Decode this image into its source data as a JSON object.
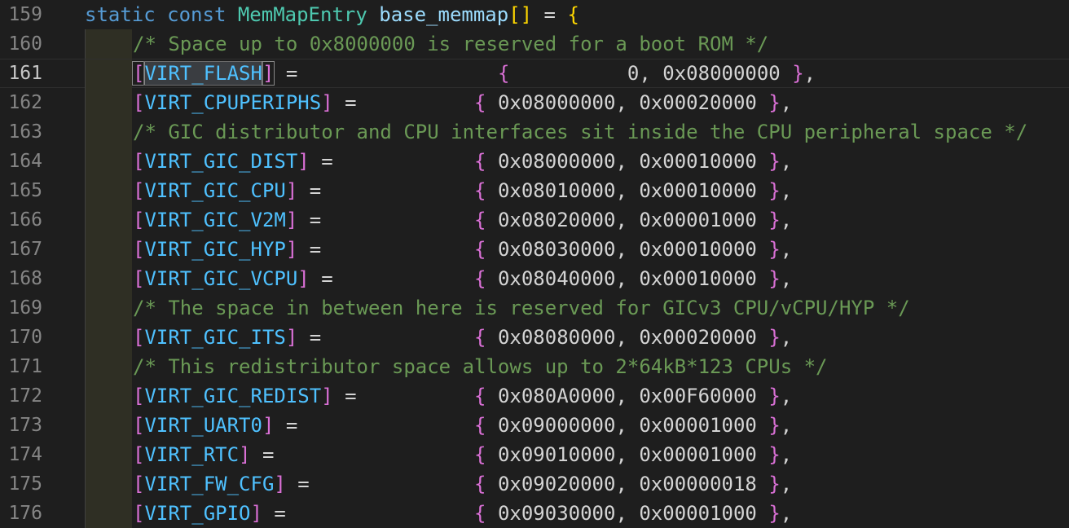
{
  "editor": {
    "lines": [
      {
        "n": "159",
        "kind": "decl",
        "kw": "static const",
        "type": "MemMapEntry",
        "name": "base_memmap",
        "open": "[]",
        "rest": " = ",
        "brace": "{"
      },
      {
        "n": "160",
        "kind": "comment",
        "text": "/* Space up to 0x8000000 is reserved for a boot ROM */"
      },
      {
        "n": "161",
        "kind": "entry",
        "id": "VIRT_FLASH",
        "pad": " =                 ",
        "a": "         0",
        "b": "0x08000000",
        "current": true
      },
      {
        "n": "162",
        "kind": "entry",
        "id": "VIRT_CPUPERIPHS",
        "pad": " =          ",
        "a": "0x08000000",
        "b": "0x00020000"
      },
      {
        "n": "163",
        "kind": "comment",
        "text": "/* GIC distributor and CPU interfaces sit inside the CPU peripheral space */"
      },
      {
        "n": "164",
        "kind": "entry",
        "id": "VIRT_GIC_DIST",
        "pad": " =            ",
        "a": "0x08000000",
        "b": "0x00010000"
      },
      {
        "n": "165",
        "kind": "entry",
        "id": "VIRT_GIC_CPU",
        "pad": " =             ",
        "a": "0x08010000",
        "b": "0x00010000"
      },
      {
        "n": "166",
        "kind": "entry",
        "id": "VIRT_GIC_V2M",
        "pad": " =             ",
        "a": "0x08020000",
        "b": "0x00001000"
      },
      {
        "n": "167",
        "kind": "entry",
        "id": "VIRT_GIC_HYP",
        "pad": " =             ",
        "a": "0x08030000",
        "b": "0x00010000"
      },
      {
        "n": "168",
        "kind": "entry",
        "id": "VIRT_GIC_VCPU",
        "pad": " =            ",
        "a": "0x08040000",
        "b": "0x00010000"
      },
      {
        "n": "169",
        "kind": "comment",
        "text": "/* The space in between here is reserved for GICv3 CPU/vCPU/HYP */"
      },
      {
        "n": "170",
        "kind": "entry",
        "id": "VIRT_GIC_ITS",
        "pad": " =             ",
        "a": "0x08080000",
        "b": "0x00020000"
      },
      {
        "n": "171",
        "kind": "comment",
        "text": "/* This redistributor space allows up to 2*64kB*123 CPUs */"
      },
      {
        "n": "172",
        "kind": "entry",
        "id": "VIRT_GIC_REDIST",
        "pad": " =          ",
        "a": "0x080A0000",
        "b": "0x00F60000"
      },
      {
        "n": "173",
        "kind": "entry",
        "id": "VIRT_UART0",
        "pad": " =               ",
        "a": "0x09000000",
        "b": "0x00001000"
      },
      {
        "n": "174",
        "kind": "entry",
        "id": "VIRT_RTC",
        "pad": " =                 ",
        "a": "0x09010000",
        "b": "0x00001000"
      },
      {
        "n": "175",
        "kind": "entry",
        "id": "VIRT_FW_CFG",
        "pad": " =              ",
        "a": "0x09020000",
        "b": "0x00000018"
      },
      {
        "n": "176",
        "kind": "entry",
        "id": "VIRT_GPIO",
        "pad": " =                ",
        "a": "0x09030000",
        "b": "0x00001000"
      }
    ]
  },
  "colors": {
    "background": "#1e1e1e",
    "keyword": "#569cd6",
    "type": "#4ec9b0",
    "identifier": "#4fc1ff",
    "comment": "#6a9955",
    "bracket_square": "#da70d6",
    "bracket_yellow": "#ffd700"
  }
}
